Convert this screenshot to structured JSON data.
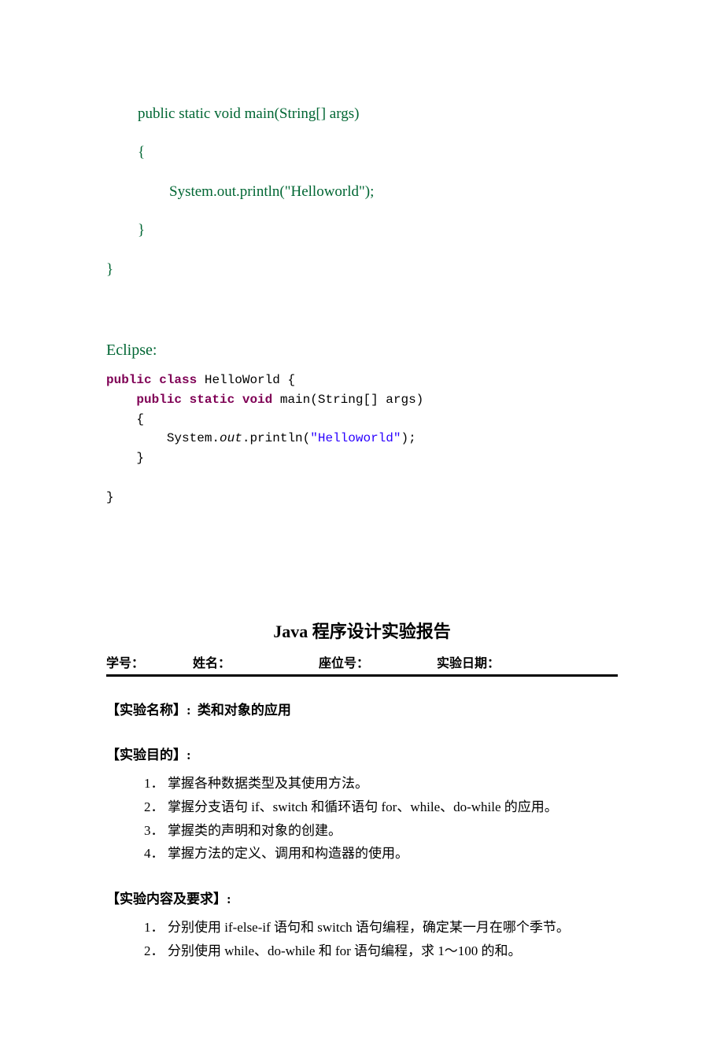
{
  "code_green": {
    "l1": "public static void main(String[] args)",
    "l2": "{",
    "l3": "System.out.println(\"Helloworld\");",
    "l4": "}",
    "l5": "}"
  },
  "eclipse_label": "Eclipse:",
  "eclipse_code": {
    "kw_public": "public",
    "kw_class": "class",
    "cls_name": " HelloWorld {",
    "kw_public2": "public",
    "kw_static": "static",
    "kw_void": "void",
    "main_sig": " main(String[] args)",
    "open_brace": "    {",
    "sys_pre": "        System.",
    "out": "out",
    "println_pre": ".println(",
    "str": "\"Helloworld\"",
    "println_post": ");",
    "close_brace": "    }",
    "close_brace2": "}"
  },
  "report": {
    "title_java": "Java ",
    "title_rest": "程序设计实验报告",
    "header": {
      "xuehao": "学号：",
      "name": "姓名：",
      "seat": "座位号：",
      "date": "实验日期："
    }
  },
  "sections": {
    "name_label": "【实验名称】:",
    "name_value": " 类和对象的应用",
    "purpose_label": "【实验目的】:",
    "purpose_items": [
      {
        "num": "1．",
        "text": "掌握各种数据类型及其使用方法。"
      },
      {
        "num": "2．",
        "text": "掌握分支语句 if、switch 和循环语句 for、while、do-while 的应用。"
      },
      {
        "num": "3．",
        "text": "掌握类的声明和对象的创建。"
      },
      {
        "num": "4．",
        "text": "掌握方法的定义、调用和构造器的使用。"
      }
    ],
    "content_label": "【实验内容及要求】:",
    "content_items": [
      {
        "num": "1．",
        "text": "分别使用 if-else-if 语句和 switch 语句编程，确定某一月在哪个季节。"
      },
      {
        "num": "2．",
        "text": "分别使用 while、do-while 和 for 语句编程，求 1～100 的和。"
      }
    ]
  }
}
